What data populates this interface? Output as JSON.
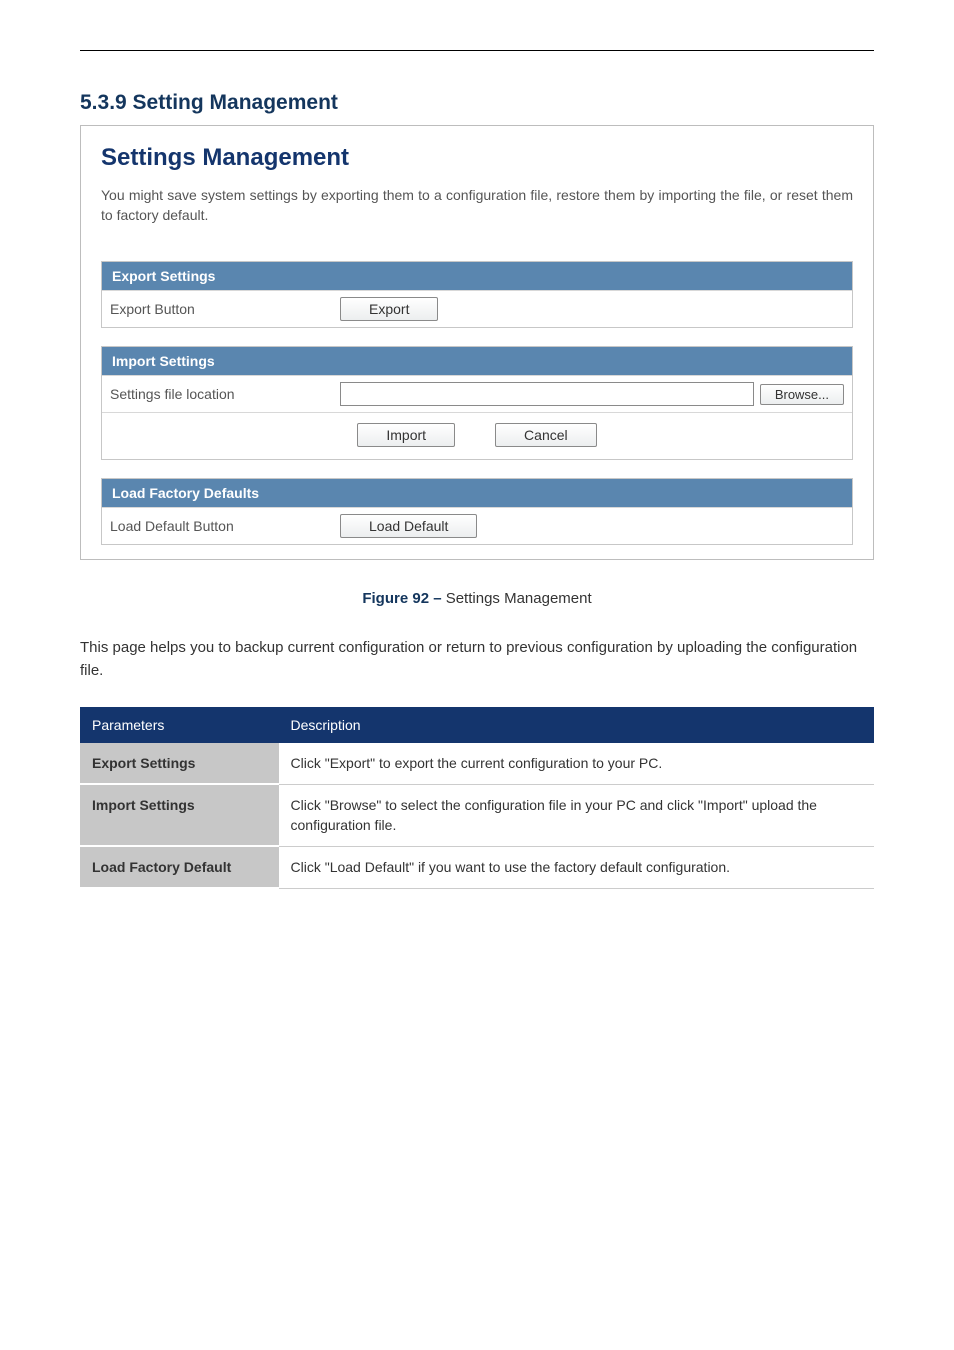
{
  "section_number": "5.3.9 Setting Management",
  "panel": {
    "title": "Settings Management",
    "description": "You might save system settings by exporting them to a configuration file, restore them by importing the file, or reset them to factory default.",
    "export": {
      "header": "Export Settings",
      "row_label": "Export Button",
      "button": "Export"
    },
    "import": {
      "header": "Import Settings",
      "row_label": "Settings file location",
      "browse": "Browse...",
      "import_btn": "Import",
      "cancel_btn": "Cancel"
    },
    "defaults": {
      "header": "Load Factory Defaults",
      "row_label": "Load Default Button",
      "button": "Load Default"
    }
  },
  "figure": {
    "num": "Figure 92 –",
    "text": " Settings Management"
  },
  "instruction": "This page helps you to backup current configuration or return to previous configuration by uploading the configuration file.",
  "table": {
    "headers": [
      "Parameters",
      "Description"
    ],
    "rows": [
      {
        "k": "Export Settings",
        "v": "Click \"Export\" to export the current configuration to your PC."
      },
      {
        "k": "Import Settings",
        "v": "Click \"Browse\" to select the configuration file in your PC and click \"Import\" upload the configuration file."
      },
      {
        "k": "Load Factory Default",
        "v": "Click \"Load Default\" if you want to use the factory default configuration."
      }
    ]
  }
}
